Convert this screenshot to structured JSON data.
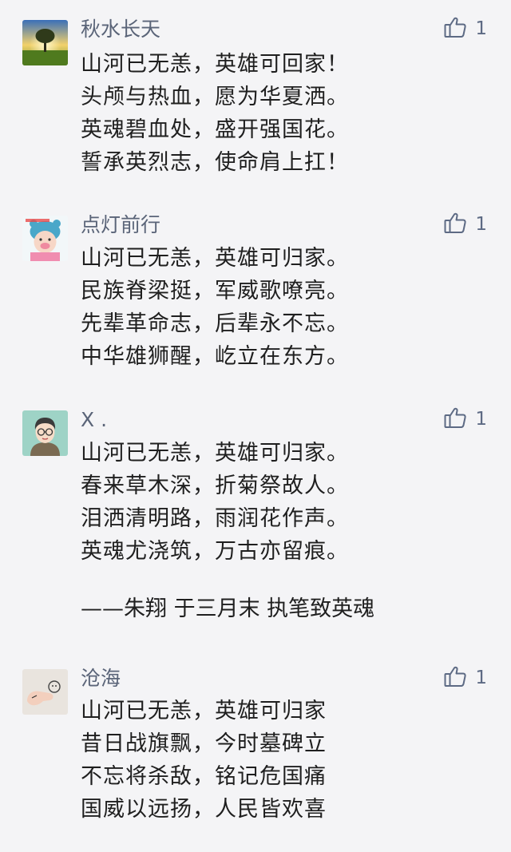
{
  "comments": [
    {
      "name": "秋水长天",
      "likes": "1",
      "lines": [
        "山河已无恙，英雄可回家！",
        "头颅与热血，愿为华夏洒。",
        "英魂碧血处，盛开强国花。",
        "誓承英烈志，使命肩上扛！"
      ]
    },
    {
      "name": "点灯前行",
      "likes": "1",
      "lines": [
        "山河已无恙，英雄可归家。",
        "民族脊梁挺，军威歌嘹亮。",
        "先辈革命志，后辈永不忘。",
        "中华雄狮醒，屹立在东方。"
      ]
    },
    {
      "name": "X .",
      "likes": "1",
      "lines": [
        "山河已无恙，英雄可归家。",
        "春来草木深，折菊祭故人。",
        "泪洒清明路，雨润花作声。",
        "英魂尤浇筑，万古亦留痕。"
      ],
      "signature": "——朱翔  于三月末  执笔致英魂"
    },
    {
      "name": "沧海",
      "likes": "1",
      "lines": [
        "山河已无恙，英雄可归家",
        "昔日战旗飘，今时墓碑立",
        "不忘将杀敌，铭记危国痛",
        "国威以远扬，人民皆欢喜"
      ]
    }
  ],
  "icons": {
    "like": "thumbs-up-outline-icon"
  },
  "colors": {
    "nickname": "#5a6478",
    "text": "#1f1f1f",
    "like": "#5d6a84",
    "background": "#f4f4f6"
  }
}
